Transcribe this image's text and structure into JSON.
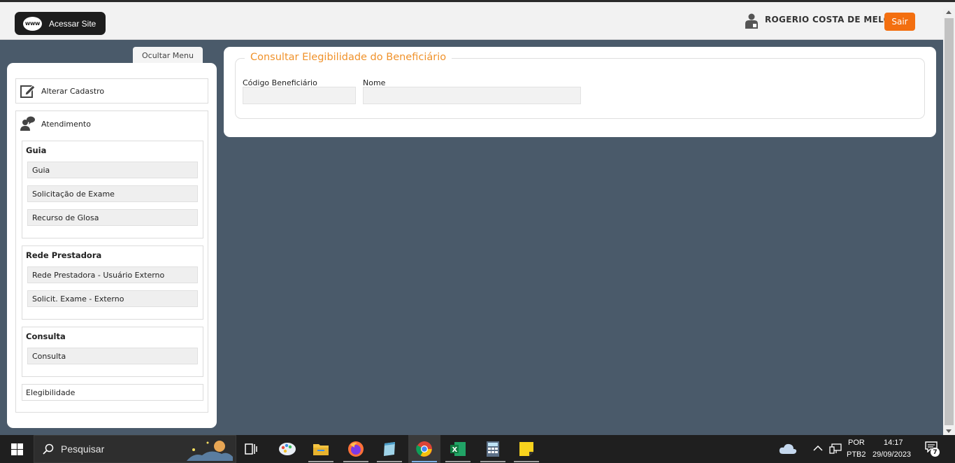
{
  "header": {
    "site_button_label": "Acessar Site",
    "site_icon_text": "www",
    "user_name": "ROGERIO COSTA DE MELO",
    "logout_label": "Sair"
  },
  "sidebar": {
    "hide_menu_label": "Ocultar Menu",
    "alter_cadastro_label": "Alterar Cadastro",
    "atendimento_label": "Atendimento",
    "groups": [
      {
        "title": "Guia",
        "items": [
          "Guia",
          "Solicitação de Exame",
          "Recurso de Glosa"
        ]
      },
      {
        "title": "Rede Prestadora",
        "items": [
          "Rede Prestadora - Usuário Externo",
          "Solicit. Exame - Externo"
        ]
      },
      {
        "title": "Consulta",
        "items": [
          "Consulta"
        ]
      }
    ],
    "elegibilidade_label": "Elegibilidade"
  },
  "main": {
    "legend": "Consultar Elegibilidade do Beneficiário",
    "codigo_label": "Código Beneficiário",
    "codigo_value": "",
    "nome_label": "Nome",
    "nome_value": ""
  },
  "taskbar": {
    "search_placeholder": "Pesquisar",
    "lang_top": "POR",
    "lang_bottom": "PTB2",
    "time": "14:17",
    "date": "29/09/2023",
    "notification_count": "7",
    "apps": [
      "task-view",
      "paint",
      "file-explorer",
      "firefox",
      "notepad",
      "chrome",
      "excel",
      "calculator",
      "sticky-notes"
    ]
  },
  "colors": {
    "background": "#4a5a6a",
    "accent_orange": "#f36f10",
    "legend_orange": "#f0922b"
  }
}
